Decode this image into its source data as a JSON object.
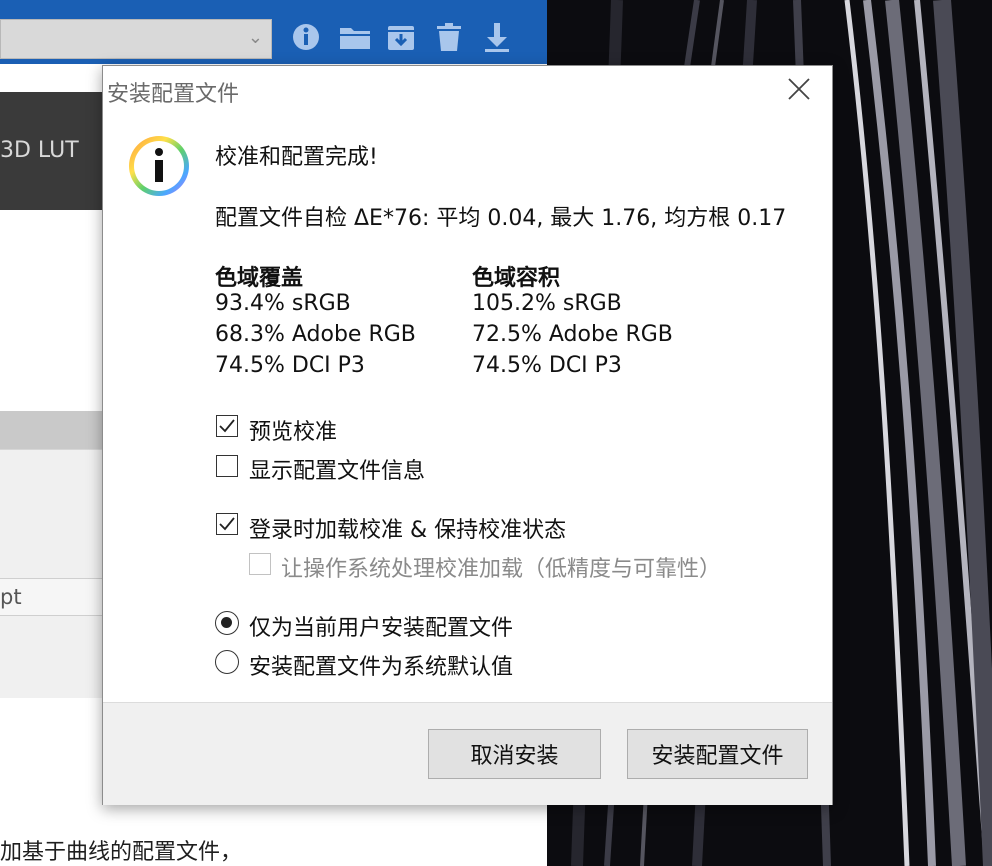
{
  "background_app": {
    "tab_3dlut": "3D LUT",
    "input_fragment": "pt",
    "bottom_fragment": "加基于曲线的配置文件，",
    "toolbar_icons": [
      "info-icon",
      "folder-icon",
      "save-icon",
      "trash-icon",
      "download-icon"
    ],
    "accent_color": "#1a5fb4"
  },
  "dialog": {
    "title": "安装配置文件",
    "heading": "校准和配置完成!",
    "self_check": "配置文件自检 ΔE*76: 平均 0.04, 最大 1.76, 均方根 0.17",
    "gamut_coverage": {
      "header": "色域覆盖",
      "rows": [
        "93.4% sRGB",
        "68.3% Adobe RGB",
        "74.5% DCI P3"
      ]
    },
    "gamut_volume": {
      "header": "色域容积",
      "rows": [
        "105.2% sRGB",
        "72.5% Adobe RGB",
        "74.5% DCI P3"
      ]
    },
    "checkboxes": [
      {
        "label": "预览校准",
        "checked": true,
        "enabled": true
      },
      {
        "label": "显示配置文件信息",
        "checked": false,
        "enabled": true
      },
      {
        "label": "登录时加载校准 & 保持校准状态",
        "checked": true,
        "enabled": true
      },
      {
        "label": "让操作系统处理校准加载（低精度与可靠性）",
        "checked": false,
        "enabled": false
      }
    ],
    "radios": [
      {
        "label": "仅为当前用户安装配置文件",
        "selected": true
      },
      {
        "label": "安装配置文件为系统默认值",
        "selected": false
      }
    ],
    "buttons": {
      "cancel": "取消安装",
      "install": "安装配置文件"
    }
  }
}
